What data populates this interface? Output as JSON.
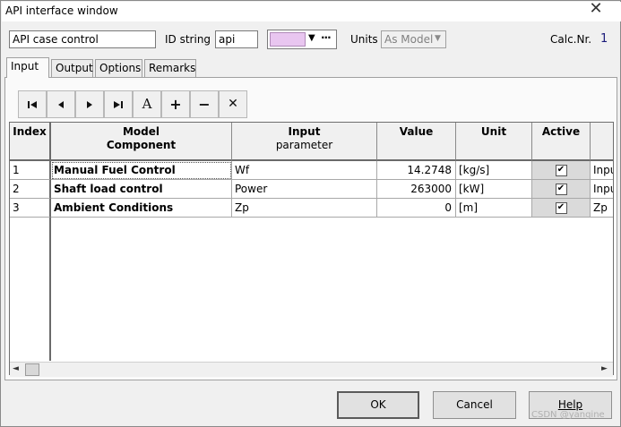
{
  "window": {
    "title": "API interface window"
  },
  "header": {
    "name_value": "API case control",
    "id_label": "ID string",
    "id_value": "api",
    "color_swatch": "#e9c6f0",
    "color_more": "···",
    "units_label": "Units",
    "units_value": "As Model",
    "calc_label": "Calc.Nr.",
    "calc_value": "1"
  },
  "tabs": [
    {
      "label": "Input",
      "active": true
    },
    {
      "label": "Output"
    },
    {
      "label": "Options"
    },
    {
      "label": "Remarks"
    }
  ],
  "toolbar": {
    "buttons": [
      {
        "icon": "first-record-icon"
      },
      {
        "icon": "previous-record-icon"
      },
      {
        "icon": "next-record-icon"
      },
      {
        "icon": "last-record-icon"
      },
      {
        "icon": "font-a-icon",
        "glyph": "A"
      },
      {
        "icon": "plus-icon",
        "glyph": "+"
      },
      {
        "icon": "minus-icon",
        "glyph": "−"
      },
      {
        "icon": "delete-x-icon",
        "glyph": "✕"
      }
    ]
  },
  "table": {
    "headers": {
      "index": "Index",
      "model_1": "Model",
      "model_2": "Component",
      "param_1": "Input",
      "param_2": "parameter",
      "value": "Value",
      "unit": "Unit",
      "active": "Active"
    },
    "rows": [
      {
        "index": "1",
        "component": "Manual Fuel Control",
        "parameter": "Wf",
        "value": "14.2748",
        "unit": "[kg/s]",
        "active": "✔",
        "extra": "Inpu"
      },
      {
        "index": "2",
        "component": "Shaft load control",
        "parameter": "Power",
        "value": "263000",
        "unit": "[kW]",
        "active": "✔",
        "extra": "Inpu"
      },
      {
        "index": "3",
        "component": "Ambient Conditions",
        "parameter": "Zp",
        "value": "0",
        "unit": "[m]",
        "active": "✔",
        "extra": "Zp"
      }
    ]
  },
  "buttons": {
    "ok": "OK",
    "cancel": "Cancel",
    "help": "Help"
  },
  "watermark": "CSDN @yangine"
}
